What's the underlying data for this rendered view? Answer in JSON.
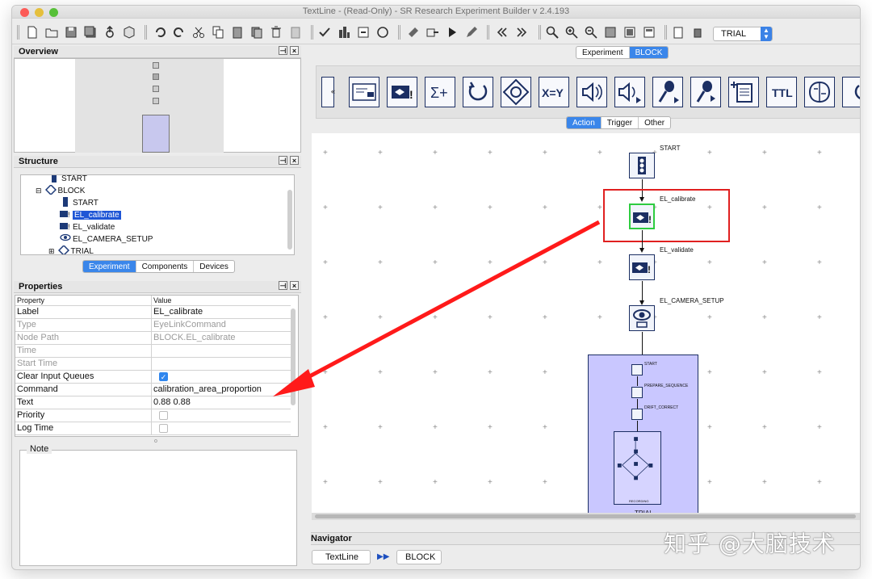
{
  "window": {
    "title": "TextLine - (Read-Only) - SR Research Experiment Builder v 2.4.193"
  },
  "toolbar": {
    "trial_select": "TRIAL"
  },
  "overview": {
    "title": "Overview"
  },
  "structure": {
    "title": "Structure",
    "items": [
      {
        "label": "START"
      },
      {
        "label": "BLOCK"
      },
      {
        "label": "START"
      },
      {
        "label": "EL_calibrate"
      },
      {
        "label": "EL_validate"
      },
      {
        "label": "EL_CAMERA_SETUP"
      },
      {
        "label": "TRIAL"
      }
    ],
    "tabs": [
      "Experiment",
      "Components",
      "Devices"
    ]
  },
  "properties": {
    "title": "Properties",
    "header": {
      "property": "Property",
      "value": "Value"
    },
    "rows": [
      {
        "key": "Label",
        "value": "EL_calibrate"
      },
      {
        "key": "Type",
        "value": "EyeLinkCommand"
      },
      {
        "key": "Node Path",
        "value": "BLOCK.EL_calibrate"
      },
      {
        "key": "Time",
        "value": ""
      },
      {
        "key": "Start Time",
        "value": ""
      },
      {
        "key": "Clear Input Queues",
        "value": ""
      },
      {
        "key": "Command",
        "value": "calibration_area_proportion"
      },
      {
        "key": "Text",
        "value": "0.88 0.88"
      },
      {
        "key": "Priority",
        "value": ""
      },
      {
        "key": "Log Time",
        "value": ""
      }
    ],
    "note_label": "Note"
  },
  "editor": {
    "top_tabs": [
      "Experiment",
      "BLOCK"
    ],
    "palette_tabs": [
      "Action",
      "Trigger",
      "Other"
    ],
    "nodes": {
      "start": "START",
      "calibrate": "EL_calibrate",
      "validate": "EL_validate",
      "camera": "EL_CAMERA_SETUP",
      "trial": "TRIAL",
      "inner_start": "START",
      "prepare": "PREPARE_SEQUENCE",
      "drift": "DRIFT_CORRECT",
      "recording": "RECORDING"
    }
  },
  "navigator": {
    "title": "Navigator",
    "crumbs": [
      "TextLine",
      "BLOCK"
    ]
  },
  "watermark": "知乎 @大脑技术",
  "colors": {
    "accent": "#3a86ea",
    "highlight_box": "#e02020",
    "trial_fill": "#c9c7ff",
    "arrow": "#ff1a1a"
  }
}
